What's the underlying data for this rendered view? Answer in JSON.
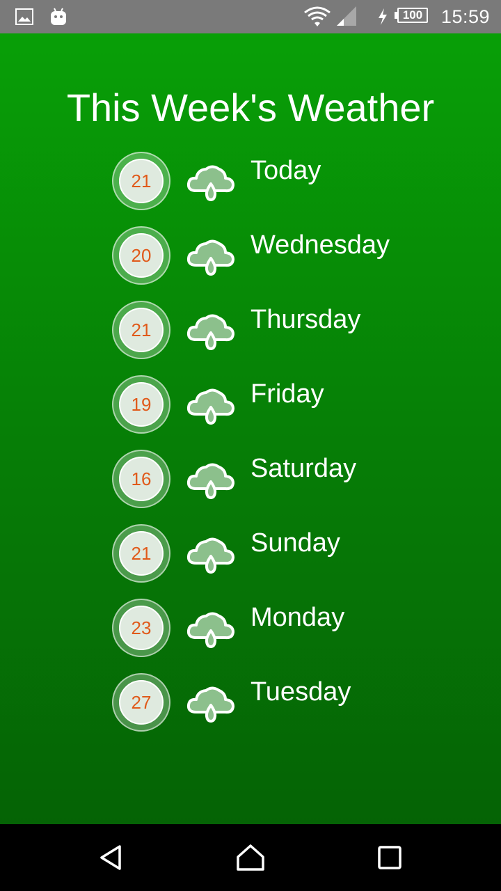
{
  "status_bar": {
    "time": "15:59",
    "battery": "100",
    "icons": [
      "gallery-icon",
      "android-icon",
      "wifi-icon",
      "signal-icon",
      "charging-icon",
      "battery-icon"
    ]
  },
  "page": {
    "title": "This Week's Weather"
  },
  "days": [
    {
      "label": "Today",
      "temp": "21",
      "icon": "rain-cloud-icon"
    },
    {
      "label": "Wednesday",
      "temp": "20",
      "icon": "rain-cloud-icon"
    },
    {
      "label": "Thursday",
      "temp": "21",
      "icon": "rain-cloud-icon"
    },
    {
      "label": "Friday",
      "temp": "19",
      "icon": "rain-cloud-icon"
    },
    {
      "label": "Saturday",
      "temp": "16",
      "icon": "rain-cloud-icon"
    },
    {
      "label": "Sunday",
      "temp": "21",
      "icon": "rain-cloud-icon"
    },
    {
      "label": "Monday",
      "temp": "23",
      "icon": "rain-cloud-icon"
    },
    {
      "label": "Tuesday",
      "temp": "27",
      "icon": "rain-cloud-icon"
    }
  ],
  "nav_bar": {
    "icons": [
      "back-icon",
      "home-icon",
      "recents-icon"
    ]
  },
  "colors": {
    "background_top": "#089f07",
    "background_bottom": "#056305",
    "temperature_text": "#e05a1a",
    "status_bar": "#7a7a7a"
  }
}
